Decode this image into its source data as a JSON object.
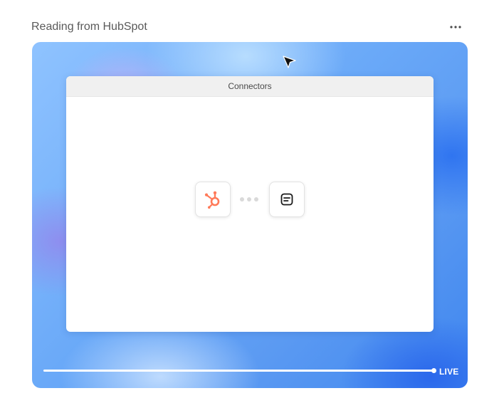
{
  "card": {
    "title": "Reading from HubSpot",
    "more_label": "More options"
  },
  "preview": {
    "window_title": "Connectors",
    "source_icon": "hubspot-icon",
    "target_icon": "document-icon",
    "playback": {
      "progress": 1.0,
      "status_label": "LIVE"
    }
  },
  "colors": {
    "hubspot": "#ff7a59",
    "background_blue": "#6aa9f8",
    "title_text": "#5a5a5a"
  }
}
